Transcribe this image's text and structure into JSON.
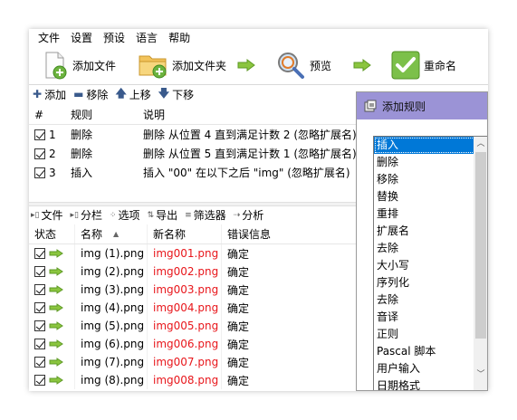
{
  "menu": [
    "文件",
    "设置",
    "预设",
    "语言",
    "帮助"
  ],
  "toolbar": {
    "add_files": "添加文件",
    "add_folder": "添加文件夹",
    "preview": "预览",
    "rename": "重命名"
  },
  "rulebar": {
    "add": "添加",
    "remove": "移除",
    "up": "上移",
    "down": "下移"
  },
  "rules": {
    "headers": {
      "hash": "#",
      "rule": "规则",
      "desc": "说明"
    },
    "rows": [
      {
        "num": "1",
        "rule": "删除",
        "desc": "删除 从位置 4 直到满足计数 2 (忽略扩展名)"
      },
      {
        "num": "2",
        "rule": "删除",
        "desc": "删除 从位置 5 直到满足计数 1 (忽略扩展名)"
      },
      {
        "num": "3",
        "rule": "插入",
        "desc": "插入 \"00\" 在以下之后 \"img\" (忽略扩展名)"
      }
    ]
  },
  "filebar": {
    "files": "文件",
    "columns": "分栏",
    "options": "选项",
    "export": "导出",
    "filters": "筛选器",
    "analyze": "分析"
  },
  "files": {
    "headers": {
      "status": "状态",
      "name": "名称",
      "new_name": "新名称",
      "error": "错误信息"
    },
    "rows": [
      {
        "name": "img (1).png",
        "new_name": "img001.png",
        "error": "确定"
      },
      {
        "name": "img (2).png",
        "new_name": "img002.png",
        "error": "确定"
      },
      {
        "name": "img (3).png",
        "new_name": "img003.png",
        "error": "确定"
      },
      {
        "name": "img (4).png",
        "new_name": "img004.png",
        "error": "确定"
      },
      {
        "name": "img (5).png",
        "new_name": "img005.png",
        "error": "确定"
      },
      {
        "name": "img (6).png",
        "new_name": "img006.png",
        "error": "确定"
      },
      {
        "name": "img (7).png",
        "new_name": "img007.png",
        "error": "确定"
      },
      {
        "name": "img (8).png",
        "new_name": "img008.png",
        "error": "确定"
      }
    ]
  },
  "dialog": {
    "title": "添加规则",
    "items": [
      "插入",
      "删除",
      "移除",
      "替换",
      "重排",
      "扩展名",
      "去除",
      "大小写",
      "序列化",
      "去除",
      "音译",
      "正则",
      "Pascal 脚本",
      "用户输入",
      "日期格式"
    ]
  },
  "colors": {
    "new_name": "#e8161b",
    "dialog_title": "#9b93d6",
    "selection": "#0078d7",
    "green_arrow": "#8bc53f"
  }
}
